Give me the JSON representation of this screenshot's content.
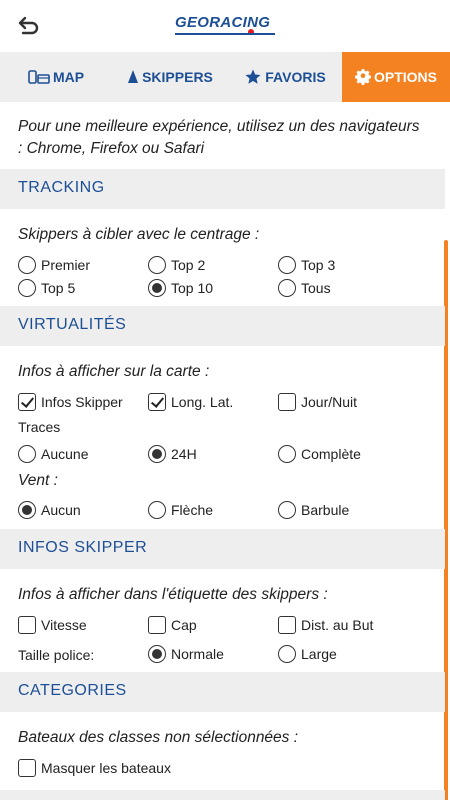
{
  "header": {
    "logo": "GEORACING"
  },
  "tabs": [
    {
      "label": "MAP",
      "icon": "map-device-icon"
    },
    {
      "label": "SKIPPERS",
      "icon": "sail-icon"
    },
    {
      "label": "FAVORIS",
      "icon": "star-icon"
    },
    {
      "label": "OPTIONS",
      "icon": "gear-icon",
      "active": true
    }
  ],
  "intro": "Pour une meilleure expérience, utilisez un des navigateurs : Chrome, Firefox ou Safari",
  "tracking": {
    "title": "TRACKING",
    "label": "Skippers à cibler avec le centrage :",
    "options": [
      "Premier",
      "Top 2",
      "Top 3",
      "Top 5",
      "Top 10",
      "Tous"
    ],
    "selected": "Top 10"
  },
  "virtualites": {
    "title": "VIRTUALITÉS",
    "label": "Infos à afficher sur la carte :",
    "checks": [
      {
        "label": "Infos Skipper",
        "checked": true
      },
      {
        "label": "Long. Lat.",
        "checked": true
      },
      {
        "label": "Jour/Nuit",
        "checked": false
      }
    ],
    "traces_label": "Traces",
    "traces": [
      "Aucune",
      "24H",
      "Complète"
    ],
    "traces_selected": "24H",
    "vent_label": "Vent :",
    "vent": [
      "Aucun",
      "Flèche",
      "Barbule"
    ],
    "vent_selected": "Aucun"
  },
  "infos_skipper": {
    "title": "INFOS SKIPPER",
    "label": "Infos à afficher dans l'étiquette des skippers :",
    "checks": [
      {
        "label": "Vitesse",
        "checked": false
      },
      {
        "label": "Cap",
        "checked": false
      },
      {
        "label": "Dist. au But",
        "checked": false
      }
    ],
    "font_label": "Taille police:",
    "font_options": [
      "Normale",
      "Large"
    ],
    "font_selected": "Normale"
  },
  "categories": {
    "title": "CATEGORIES",
    "label": "Bateaux des classes non sélectionnées :",
    "checks": [
      {
        "label": "Masquer les bateaux",
        "checked": false
      }
    ]
  },
  "colors": {
    "accent": "#f58220",
    "brand": "#1d4f96",
    "section_bg": "#eeeeee"
  }
}
